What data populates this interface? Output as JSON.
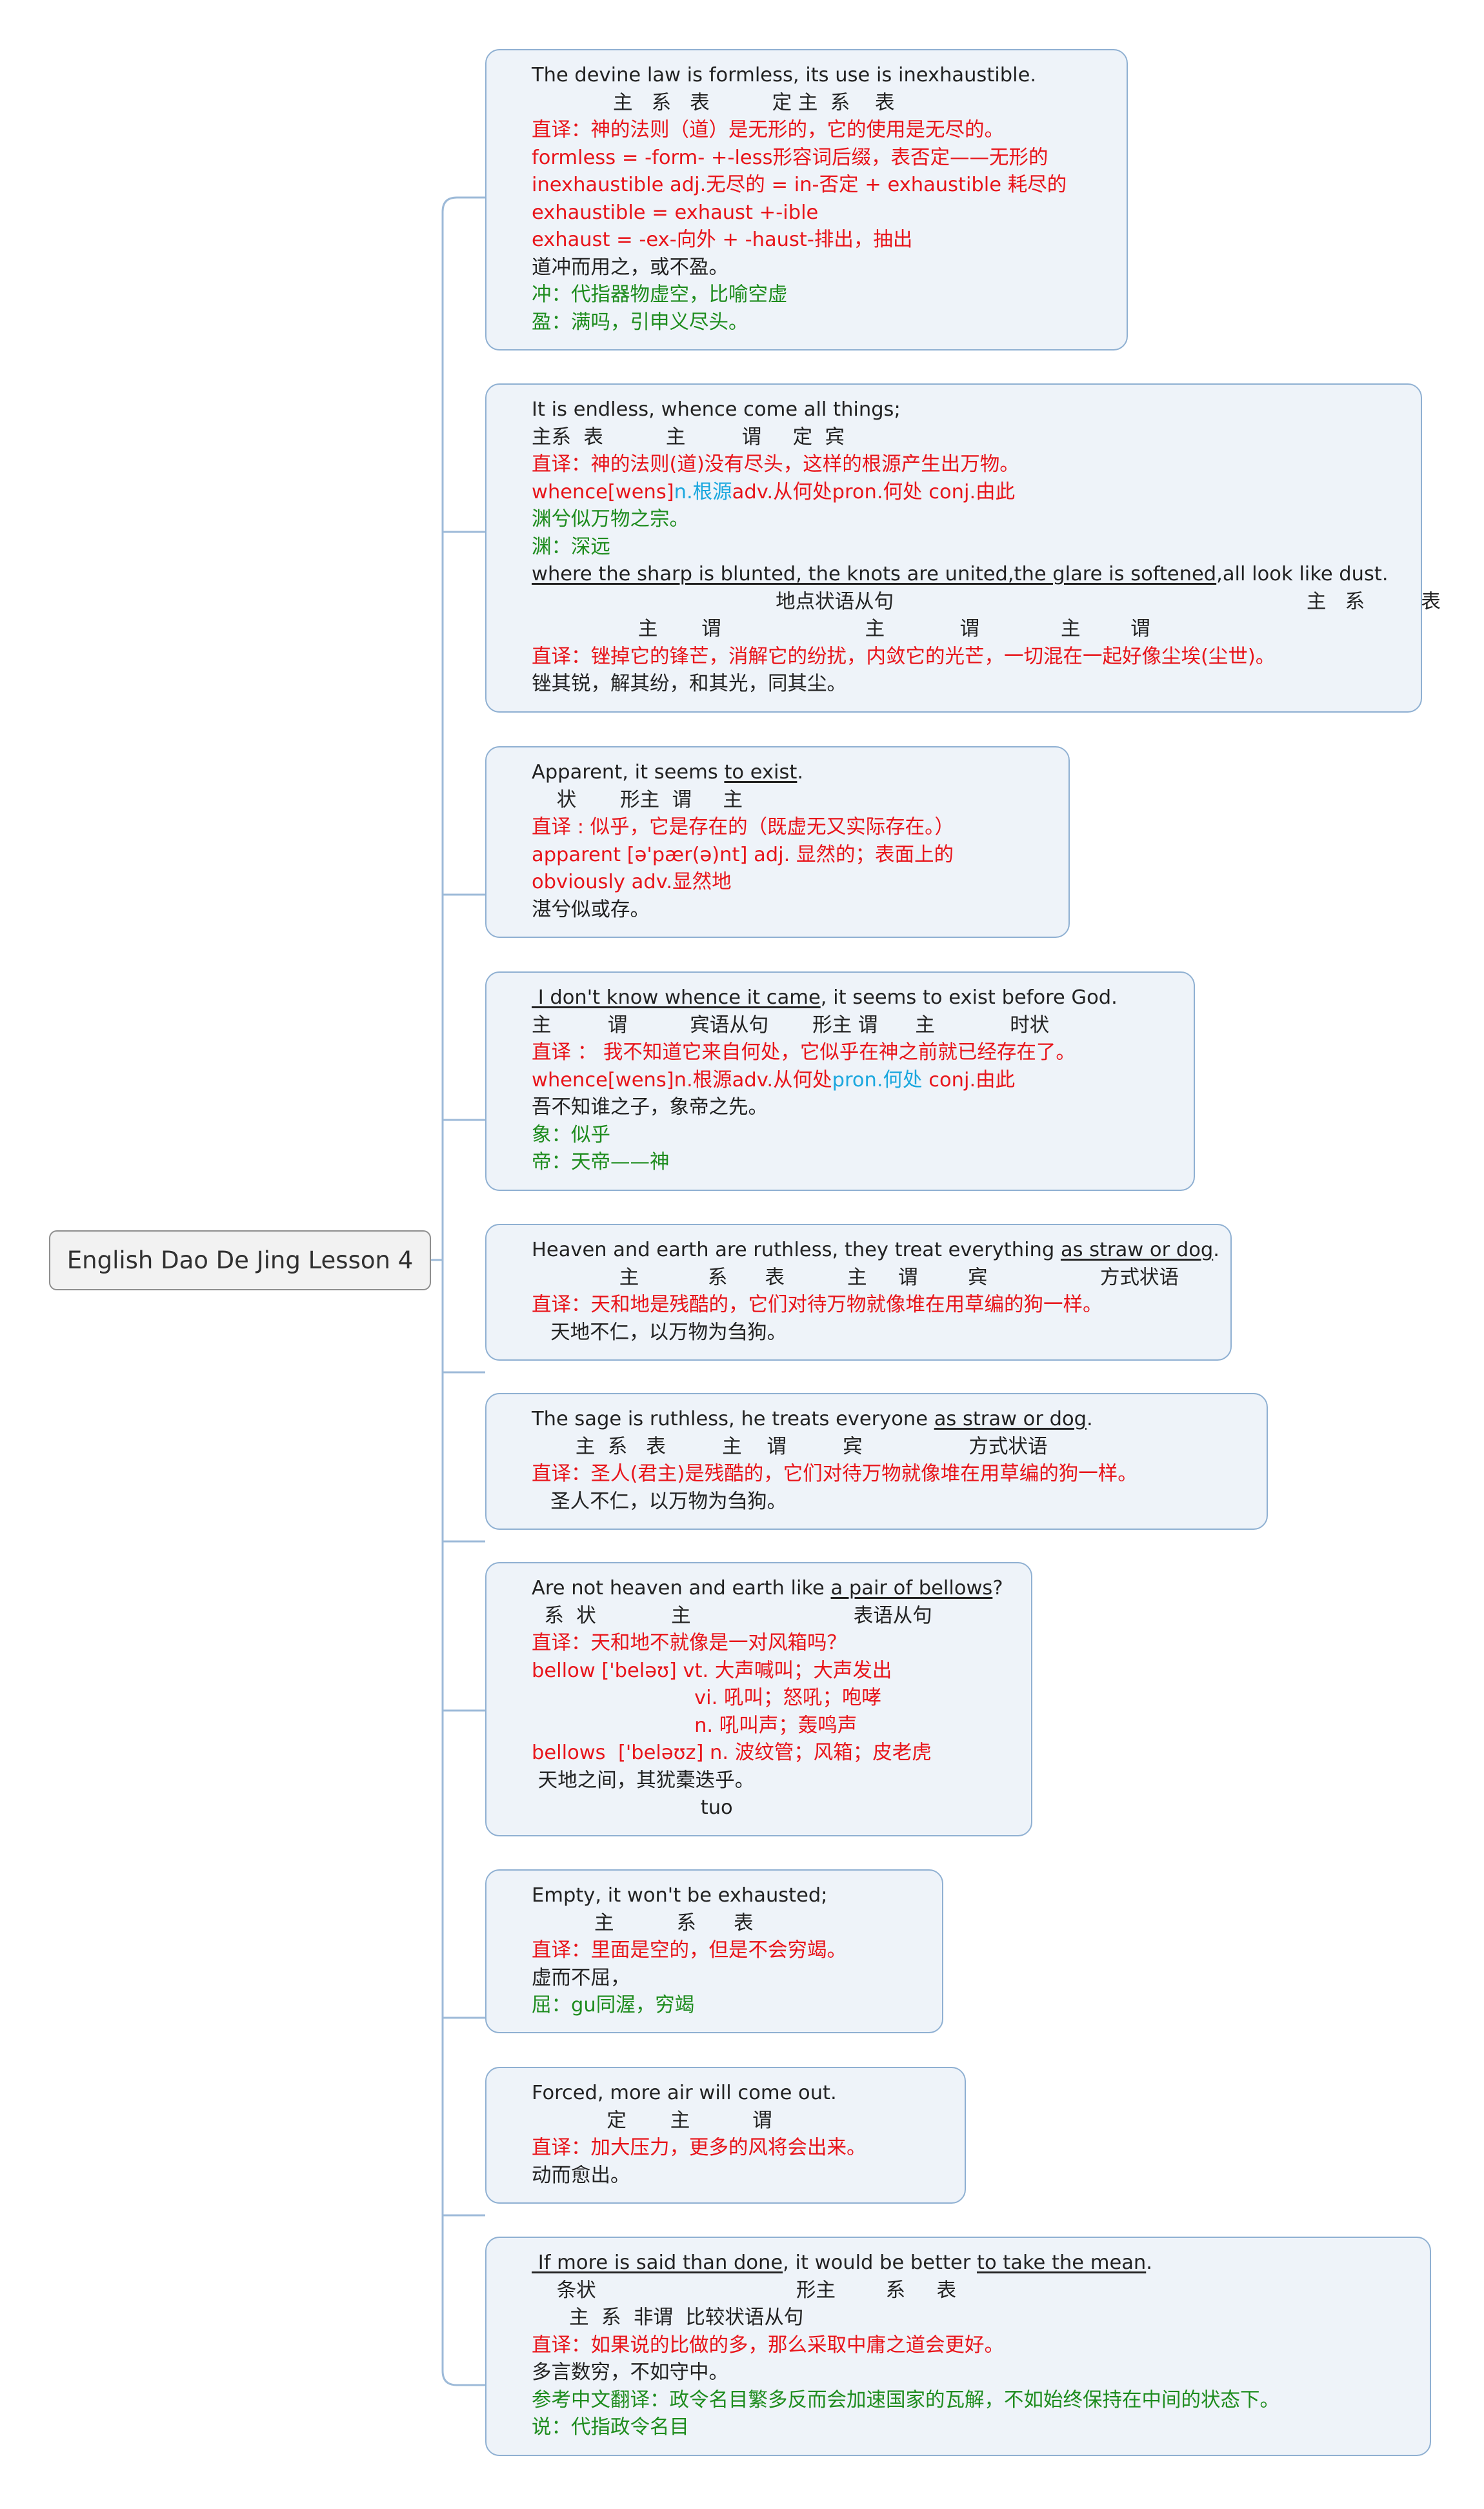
{
  "root": {
    "label": "English Dao De Jing Lesson 4"
  },
  "colors": {
    "black": "#222222",
    "red": "#e8141a",
    "green": "#1e8c1e",
    "cyan": "#1aa7de",
    "node_fill": "#eef3f9",
    "node_border": "#8fb0d2",
    "root_fill": "#f2f2f2",
    "root_border": "#8e8e8e",
    "connector": "#9dbad8"
  },
  "topics": [
    {
      "lines": [
        {
          "color": "black",
          "segments": [
            {
              "text": "The devine law is formless, its use is inexhaustible."
            }
          ]
        },
        {
          "color": "black",
          "segments": [
            {
              "text": "             主   系   表          定 主  系    表"
            }
          ]
        },
        {
          "color": "red",
          "segments": [
            {
              "text": "直译：神的法则（道）是无形的，它的使用是无尽的。"
            }
          ]
        },
        {
          "color": "red",
          "segments": [
            {
              "text": "formless = -form- +-less形容词后缀，表否定——无形的"
            }
          ]
        },
        {
          "color": "red",
          "segments": [
            {
              "text": "inexhaustible adj.无尽的 = in-否定 + exhaustible 耗尽的"
            }
          ]
        },
        {
          "color": "red",
          "segments": [
            {
              "text": "exhaustible = exhaust +-ible"
            }
          ]
        },
        {
          "color": "red",
          "segments": [
            {
              "text": "exhaust = -ex-向外 + -haust-排出，抽出"
            }
          ]
        },
        {
          "color": "black",
          "segments": [
            {
              "text": "道冲而用之，或不盈。"
            }
          ]
        },
        {
          "color": "green",
          "segments": [
            {
              "text": "冲：代指器物虚空，比喻空虚"
            }
          ]
        },
        {
          "color": "green",
          "segments": [
            {
              "text": "盈：满吗，引申义尽头。"
            }
          ]
        }
      ]
    },
    {
      "lines": [
        {
          "color": "black",
          "segments": [
            {
              "text": "It is endless, whence come all things;"
            }
          ]
        },
        {
          "color": "black",
          "segments": [
            {
              "text": "主系  表          主         谓     定  宾"
            }
          ]
        },
        {
          "color": "red",
          "segments": [
            {
              "text": "直译：神的法则(道)没有尽头，这样的根源产生出万物。"
            }
          ]
        },
        {
          "color": "red",
          "segments": [
            {
              "text": "whence[wens]"
            },
            {
              "text": "n.根源",
              "color": "cyan"
            },
            {
              "text": "adv.从何处pron.何处 conj.由此"
            }
          ]
        },
        {
          "color": "green",
          "segments": [
            {
              "text": "渊兮似万物之宗。"
            }
          ]
        },
        {
          "color": "green",
          "segments": [
            {
              "text": "渊：深远"
            }
          ]
        },
        {
          "color": "black",
          "segments": [
            {
              "text": "where the sharp is blunted, the knots are united,the glare is softened",
              "u": true
            },
            {
              "text": ",all look like dust."
            }
          ]
        },
        {
          "color": "black",
          "segments": [
            {
              "text": "                                       地点状语从句                                                                  主   系         表"
            }
          ]
        },
        {
          "color": "black",
          "segments": [
            {
              "text": "                 主       谓                       主            谓             主        谓"
            }
          ]
        },
        {
          "color": "red",
          "segments": [
            {
              "text": "直译：锉掉它的锋芒，消解它的纷扰，内敛它的光芒，一切混在一起好像尘埃(尘世)。"
            }
          ]
        },
        {
          "color": "black",
          "segments": [
            {
              "text": "锉其锐，解其纷，和其光，同其尘。"
            }
          ]
        }
      ]
    },
    {
      "lines": [
        {
          "color": "black",
          "segments": [
            {
              "text": "Apparent, it seems "
            },
            {
              "text": "to exist",
              "u": true
            },
            {
              "text": "."
            }
          ]
        },
        {
          "color": "black",
          "segments": [
            {
              "text": "    状       形主  谓     主"
            }
          ]
        },
        {
          "color": "red",
          "segments": [
            {
              "text": "直译 : 似乎，它是存在的（既虚无又实际存在。）"
            }
          ]
        },
        {
          "color": "red",
          "segments": [
            {
              "text": "apparent [ə'pær(ə)nt] adj. 显然的；表面上的"
            }
          ]
        },
        {
          "color": "red",
          "segments": [
            {
              "text": "obviously adv.显然地"
            }
          ]
        },
        {
          "color": "black",
          "segments": [
            {
              "text": "湛兮似或存。"
            }
          ]
        }
      ]
    },
    {
      "lines": [
        {
          "color": "black",
          "segments": [
            {
              "text": " I don't know whence it came",
              "u": true
            },
            {
              "text": ", it seems to exist before God."
            }
          ]
        },
        {
          "color": "black",
          "segments": [
            {
              "text": "主         谓          宾语从句       形主 谓      主            时状"
            }
          ]
        },
        {
          "color": "red",
          "segments": [
            {
              "text": "直译 ： 我不知道它来自何处，它似乎在神之前就已经存在了。"
            }
          ]
        },
        {
          "color": "red",
          "segments": [
            {
              "text": "whence[wens]n.根源adv.从何处"
            },
            {
              "text": "pron.何处",
              "color": "cyan"
            },
            {
              "text": " conj.由此"
            }
          ]
        },
        {
          "color": "black",
          "segments": [
            {
              "text": "吾不知谁之子，象帝之先。"
            }
          ]
        },
        {
          "color": "green",
          "segments": [
            {
              "text": "象：似乎"
            }
          ]
        },
        {
          "color": "green",
          "segments": [
            {
              "text": "帝：天帝——神"
            }
          ]
        }
      ]
    },
    {
      "lines": [
        {
          "color": "black",
          "segments": [
            {
              "text": "Heaven and earth are ruthless, they treat everything "
            },
            {
              "text": "as straw or dog",
              "u": true
            },
            {
              "text": "."
            }
          ]
        },
        {
          "color": "black",
          "segments": [
            {
              "text": "              主           系      表          主     谓        宾                  方式状语"
            }
          ]
        },
        {
          "color": "red",
          "segments": [
            {
              "text": "直译：天和地是残酷的，它们对待万物就像堆在用草编的狗一样。"
            }
          ]
        },
        {
          "color": "black",
          "segments": [
            {
              "text": "   天地不仁，以万物为刍狗。"
            }
          ]
        }
      ]
    },
    {
      "lines": [
        {
          "color": "black",
          "segments": [
            {
              "text": "The sage is ruthless, he treats everyone "
            },
            {
              "text": "as straw or dog",
              "u": true
            },
            {
              "text": "."
            }
          ]
        },
        {
          "color": "black",
          "segments": [
            {
              "text": "       主  系   表         主    谓         宾                 方式状语"
            }
          ]
        },
        {
          "color": "red",
          "segments": [
            {
              "text": "直译：圣人(君主)是残酷的，它们对待万物就像堆在用草编的狗一样。"
            }
          ]
        },
        {
          "color": "black",
          "segments": [
            {
              "text": "   圣人不仁，以万物为刍狗。"
            }
          ]
        }
      ]
    },
    {
      "lines": [
        {
          "color": "black",
          "segments": [
            {
              "text": "Are not heaven and earth like "
            },
            {
              "text": "a pair of bellows",
              "u": true
            },
            {
              "text": "?"
            }
          ]
        },
        {
          "color": "black",
          "segments": [
            {
              "text": "  系  状            主                          表语从句"
            }
          ]
        },
        {
          "color": "red",
          "segments": [
            {
              "text": "直译：天和地不就像是一对风箱吗？"
            }
          ]
        },
        {
          "color": "red",
          "segments": [
            {
              "text": "bellow ['beləʊ] vt. 大声喊叫；大声发出"
            }
          ]
        },
        {
          "color": "red",
          "segments": [
            {
              "text": "                          vi. 吼叫；怒吼；咆哮"
            }
          ]
        },
        {
          "color": "red",
          "segments": [
            {
              "text": "                          n. 吼叫声；轰鸣声"
            }
          ]
        },
        {
          "color": "red",
          "segments": [
            {
              "text": "bellows  ['beləʊz] n. 波纹管；风箱；皮老虎"
            }
          ]
        },
        {
          "color": "black",
          "segments": [
            {
              "text": " 天地之间，其犹橐迭乎。"
            }
          ]
        },
        {
          "color": "black",
          "segments": [
            {
              "text": "                           tuo"
            }
          ]
        }
      ]
    },
    {
      "lines": [
        {
          "color": "black",
          "segments": [
            {
              "text": "Empty, it won't be exhausted;"
            }
          ]
        },
        {
          "color": "black",
          "segments": [
            {
              "text": "          主          系      表"
            }
          ]
        },
        {
          "color": "red",
          "segments": [
            {
              "text": "直译：里面是空的，但是不会穷竭。"
            }
          ]
        },
        {
          "color": "black",
          "segments": [
            {
              "text": "虚而不屈，"
            }
          ]
        },
        {
          "color": "green",
          "segments": [
            {
              "text": "屈：gu同渥，穷竭"
            }
          ]
        }
      ]
    },
    {
      "lines": [
        {
          "color": "black",
          "segments": [
            {
              "text": "Forced, more air will come out."
            }
          ]
        },
        {
          "color": "black",
          "segments": [
            {
              "text": "            定       主          谓"
            }
          ]
        },
        {
          "color": "red",
          "segments": [
            {
              "text": "直译：加大压力，更多的风将会出来。"
            }
          ]
        },
        {
          "color": "black",
          "segments": [
            {
              "text": "动而愈出。"
            }
          ]
        }
      ]
    },
    {
      "lines": [
        {
          "color": "black",
          "segments": [
            {
              "text": " If more is said than done",
              "u": true
            },
            {
              "text": ", it would be better "
            },
            {
              "text": "to take the mean",
              "u": true
            },
            {
              "text": "."
            }
          ]
        },
        {
          "color": "black",
          "segments": [
            {
              "text": "    条状                                形主        系     表"
            }
          ]
        },
        {
          "color": "black",
          "segments": [
            {
              "text": "      主  系  非谓  比较状语从句"
            }
          ]
        },
        {
          "color": "red",
          "segments": [
            {
              "text": "直译：如果说的比做的多，那么采取中庸之道会更好。"
            }
          ]
        },
        {
          "color": "black",
          "segments": [
            {
              "text": "多言数穷，不如守中。"
            }
          ]
        },
        {
          "color": "green",
          "segments": [
            {
              "text": "参考中文翻译：政令名目繁多反而会加速国家的瓦解，不如始终保持在中间的状态下。"
            }
          ]
        },
        {
          "color": "green",
          "segments": [
            {
              "text": "说：代指政令名目"
            }
          ]
        }
      ]
    }
  ]
}
